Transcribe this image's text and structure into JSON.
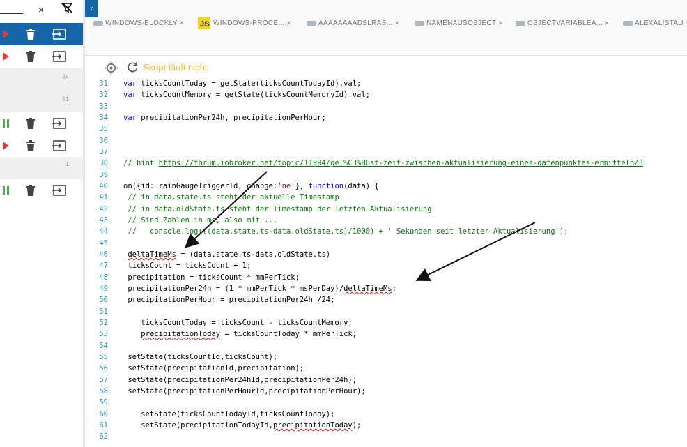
{
  "left_panel": {
    "filter_clear": "×",
    "rows": [
      {
        "state": "play",
        "selected": true,
        "number": ""
      },
      {
        "state": "play",
        "selected": false,
        "number": ""
      },
      {
        "state": "none",
        "selected": false,
        "number": "34",
        "gray": true
      },
      {
        "state": "none",
        "selected": false,
        "number": "51",
        "gray": true
      },
      {
        "state": "pause",
        "selected": false,
        "number": ""
      },
      {
        "state": "play",
        "selected": false,
        "number": ""
      },
      {
        "state": "none",
        "selected": false,
        "number": "1",
        "gray": true
      },
      {
        "state": "pause",
        "selected": false,
        "number": ""
      }
    ]
  },
  "colors": {
    "accent": "#1565a7",
    "play": "#e53935",
    "pause": "#4caf50",
    "status": "#f7b731",
    "keyword": "#0000ff",
    "comment": "#008000",
    "string": "#a31515",
    "line_number": "#2b91af"
  },
  "tabs": [
    {
      "icon": "script-badge-icon",
      "label": "WINDOWS-BLOCKLY"
    },
    {
      "icon": "js-icon",
      "label": "WINDOWS-PROCE..."
    },
    {
      "icon": "script-badge-icon",
      "label": "AAAAAAAADSLRAS..."
    },
    {
      "icon": "script-badge-icon",
      "label": "NAMENAUSOBJECT"
    },
    {
      "icon": "script-badge-icon",
      "label": "OBJECTVARIABLEA..."
    },
    {
      "icon": "script-badge-icon",
      "label": "ALEXALISTAU"
    }
  ],
  "js_badge": "JS",
  "tab_close": "×",
  "collapse_glyph": "‹",
  "toolbar": {
    "status": "Skript läuft nicht"
  },
  "code_lines": [
    {
      "n": "31",
      "text": "var ticksCountToday = getState(ticksCountTodayId).val;"
    },
    {
      "n": "32",
      "text": "var ticksCountMemory = getState(ticksCountMemoryId).val;"
    },
    {
      "n": "33",
      "text": ""
    },
    {
      "n": "34",
      "text": "var precipitationPer24h, precipitationPerHour;"
    },
    {
      "n": "35",
      "text": ""
    },
    {
      "n": "36",
      "text": ""
    },
    {
      "n": "37",
      "text": ""
    },
    {
      "n": "38",
      "text": "// hint https://forum.iobroker.net/topic/11994/gel%C3%B6st-zeit-zwischen-aktualisierung-eines-datenpunktes-ermitteln/3"
    },
    {
      "n": "39",
      "text": ""
    },
    {
      "n": "40",
      "text": "on({id: rainGaugeTriggerId, change:'ne'}, function(data) {"
    },
    {
      "n": "41",
      "text": " // in data.state.ts steht der aktuelle Timestamp"
    },
    {
      "n": "42",
      "text": " // in data.oldState.ts steht der Timestamp der letzten Aktualisierung"
    },
    {
      "n": "43",
      "text": " // Sind Zahlen in ms, also mit ..."
    },
    {
      "n": "44",
      "text": " //   console.log(((data.state.ts-data.oldState.ts)/1000) + ' Sekunden seit letzter Aktualisierung');"
    },
    {
      "n": "45",
      "text": ""
    },
    {
      "n": "46",
      "text": " deltaTimeMs = (data.state.ts-data.oldState.ts)"
    },
    {
      "n": "47",
      "text": " ticksCount = ticksCount + 1;"
    },
    {
      "n": "48",
      "text": " precipitation = ticksCount * mmPerTick;"
    },
    {
      "n": "49",
      "text": " precipitationPer24h = (1 * mmPerTick * msPerDay)/deltaTimeMs;"
    },
    {
      "n": "50",
      "text": " precipitationPerHour = precipitationPer24h /24;"
    },
    {
      "n": "51",
      "text": ""
    },
    {
      "n": "52",
      "text": "    ticksCountToday = ticksCount - ticksCountMemory;"
    },
    {
      "n": "53",
      "text": "    precipitationToday = ticksCountToday * mmPerTick;"
    },
    {
      "n": "54",
      "text": ""
    },
    {
      "n": "55",
      "text": " setState(ticksCountId,ticksCount);"
    },
    {
      "n": "56",
      "text": " setState(precipitationId,precipitation);"
    },
    {
      "n": "57",
      "text": " setState(precipitationPer24hId,precipitationPer24h);"
    },
    {
      "n": "58",
      "text": " setState(precipitationPerHourId,precipitationPerHour);"
    },
    {
      "n": "59",
      "text": ""
    },
    {
      "n": "60",
      "text": "    setState(ticksCountTodayId,ticksCountToday);"
    },
    {
      "n": "61",
      "text": "    setState(precipitationTodayId,precipitationToday);"
    },
    {
      "n": "62",
      "text": ""
    }
  ]
}
